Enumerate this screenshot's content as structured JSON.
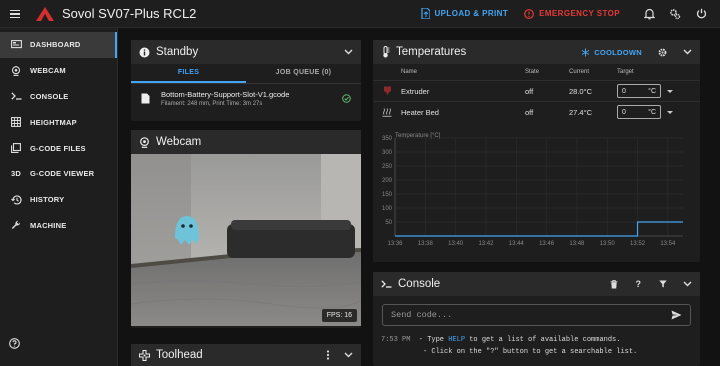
{
  "app": {
    "title": "Sovol SV07-Plus RCL2"
  },
  "topbar": {
    "upload_label": "UPLOAD & PRINT",
    "estop_label": "EMERGENCY STOP"
  },
  "sidebar": {
    "items": [
      {
        "label": "DASHBOARD",
        "icon": "monitor-icon",
        "active": true
      },
      {
        "label": "WEBCAM",
        "icon": "webcam-icon"
      },
      {
        "label": "CONSOLE",
        "icon": "console-icon"
      },
      {
        "label": "HEIGHTMAP",
        "icon": "grid-icon"
      },
      {
        "label": "G-CODE FILES",
        "icon": "files-icon"
      },
      {
        "label": "G-CODE VIEWER",
        "icon": "3d-icon"
      },
      {
        "label": "HISTORY",
        "icon": "history-icon"
      },
      {
        "label": "MACHINE",
        "icon": "wrench-icon"
      }
    ],
    "viewer_badge": "3D"
  },
  "standby": {
    "title": "Standby",
    "tabs": [
      "FILES",
      "JOB QUEUE (0)"
    ],
    "file": {
      "name": "Bottom-Battery-Support-Slot-V1.gcode",
      "meta": "Filament: 248 mm, Print Time: 3m 27s"
    }
  },
  "webcam": {
    "title": "Webcam",
    "fps": "FPS: 16"
  },
  "toolhead": {
    "title": "Toolhead"
  },
  "temperatures": {
    "title": "Temperatures",
    "cooldown_label": "COOLDOWN",
    "columns": [
      "Name",
      "State",
      "Current",
      "Target"
    ],
    "rows": [
      {
        "name": "Extruder",
        "state": "off",
        "current": "28.0°C",
        "target": "0",
        "unit": "°C"
      },
      {
        "name": "Heater Bed",
        "state": "off",
        "current": "27.4°C",
        "target": "0",
        "unit": "°C"
      }
    ]
  },
  "chart_data": {
    "type": "line",
    "title": "",
    "ylabel": "Temperature [°C]",
    "xlabel": "",
    "ylim": [
      0,
      350
    ],
    "y_ticks": [
      0,
      50,
      100,
      150,
      200,
      250,
      300,
      350
    ],
    "x_ticks": [
      "13:36",
      "13:38",
      "13:40",
      "13:42",
      "13:44",
      "13:46",
      "13:48",
      "13:50",
      "13:52",
      "13:54"
    ],
    "grid": true,
    "series": [
      {
        "values": [
          0,
          0,
          0,
          0,
          0,
          0,
          0,
          0,
          0,
          50,
          50
        ],
        "x": [
          "13:36",
          "13:38",
          "13:40",
          "13:42",
          "13:44",
          "13:46",
          "13:48",
          "13:50",
          "13:52",
          "13:52",
          "13:55"
        ],
        "color": "#42a5f5"
      }
    ]
  },
  "console": {
    "title": "Console",
    "placeholder": "Send code...",
    "lines": [
      {
        "time": "7:53 PM",
        "pre": "  - Type ",
        "keyword": "HELP",
        "post": " to get a list of available commands."
      },
      {
        "time": "",
        "pre": "          - Click on the \"?\" button to get a searchable list.",
        "keyword": "",
        "post": ""
      }
    ]
  },
  "colors": {
    "accent": "#42a5f5",
    "danger": "#e53935",
    "background": "#121212",
    "card": "#1e1e1e"
  }
}
